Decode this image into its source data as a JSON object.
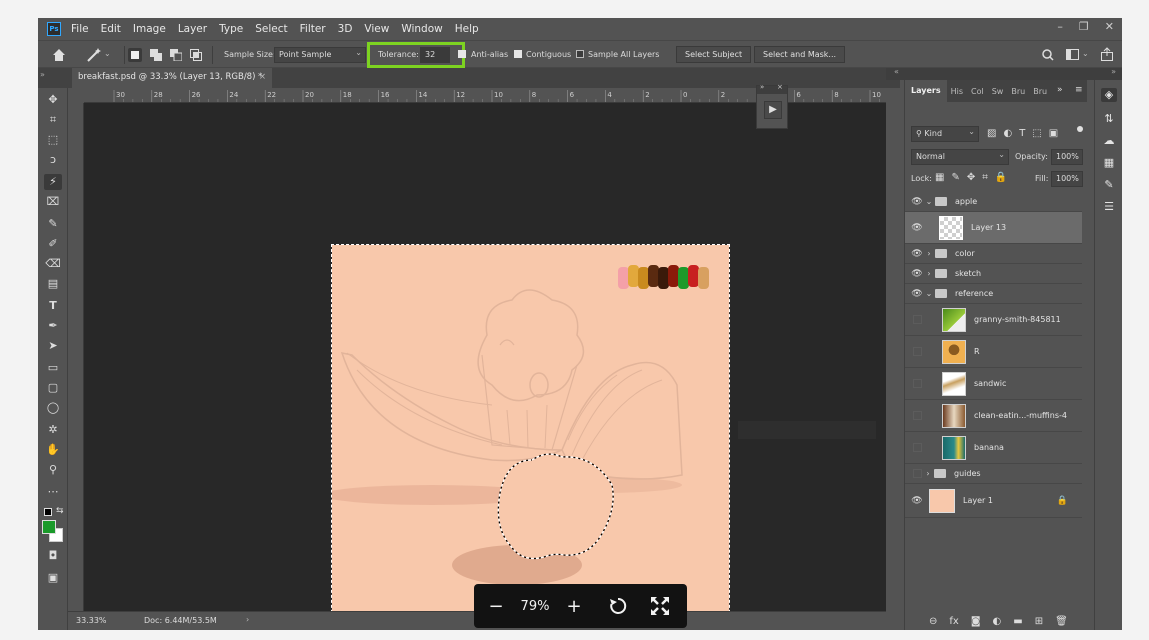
{
  "menubar": {
    "logo": "Ps",
    "items": [
      "File",
      "Edit",
      "Image",
      "Layer",
      "Type",
      "Select",
      "Filter",
      "3D",
      "View",
      "Window",
      "Help"
    ],
    "window_controls": [
      "–",
      "❐",
      "✕"
    ]
  },
  "options": {
    "sample_size_label": "Sample Size:",
    "sample_size_value": "Point Sample",
    "tolerance_label": "Tolerance:",
    "tolerance_value": "32",
    "anti_alias": "Anti-alias",
    "contiguous": "Contiguous",
    "sample_all_layers": "Sample All Layers",
    "select_subject": "Select Subject",
    "select_and_mask": "Select and Mask...",
    "highlight_color": "#7dd321"
  },
  "document": {
    "tab_title": "breakfast.psd @ 33.3% (Layer 13, RGB/8) *",
    "ruler_ticks": [
      "30",
      "28",
      "26",
      "24",
      "22",
      "20",
      "18",
      "16",
      "14",
      "12",
      "10",
      "8",
      "6",
      "4",
      "2",
      "0",
      "2",
      "4",
      "6",
      "8",
      "10"
    ],
    "canvas_color": "#f8c8ab",
    "swatch_colors": [
      "#f4a0a8",
      "#e2a83c",
      "#c98a1e",
      "#5a2a10",
      "#3a1a0a",
      "#8a1a0a",
      "#1e9a2a",
      "#c82020",
      "#d8a060"
    ]
  },
  "status": {
    "zoom": "33.33%",
    "doc_size": "Doc: 6.44M/53.5M"
  },
  "layers_panel": {
    "tabs": [
      "Layers",
      "His",
      "Col",
      "Sw",
      "Bru",
      "Bru"
    ],
    "filter_kind": "Kind",
    "blend_mode": "Normal",
    "opacity_label": "Opacity:",
    "opacity_value": "100%",
    "lock_label": "Lock:",
    "fill_label": "Fill:",
    "fill_value": "100%",
    "layers": [
      {
        "name": "apple",
        "type": "group",
        "visible": true,
        "expanded": true
      },
      {
        "name": "Layer 13",
        "type": "layer",
        "visible": true,
        "selected": true
      },
      {
        "name": "color",
        "type": "group",
        "visible": true,
        "expanded": false
      },
      {
        "name": "sketch",
        "type": "group",
        "visible": true,
        "expanded": false
      },
      {
        "name": "reference",
        "type": "group",
        "visible": true,
        "expanded": true
      },
      {
        "name": "granny-smith-845811",
        "type": "layer",
        "visible": false
      },
      {
        "name": "R",
        "type": "layer",
        "visible": false
      },
      {
        "name": "sandwic",
        "type": "layer",
        "visible": false
      },
      {
        "name": "clean-eatin...-muffins-4",
        "type": "layer",
        "visible": false
      },
      {
        "name": "banana",
        "type": "layer",
        "visible": false
      },
      {
        "name": "guides",
        "type": "group",
        "visible": false,
        "expanded": false
      },
      {
        "name": "Layer 1",
        "type": "layer",
        "visible": true,
        "locked": true
      }
    ]
  },
  "zoom_overlay": {
    "minus": "−",
    "value": "79%",
    "plus": "+"
  }
}
